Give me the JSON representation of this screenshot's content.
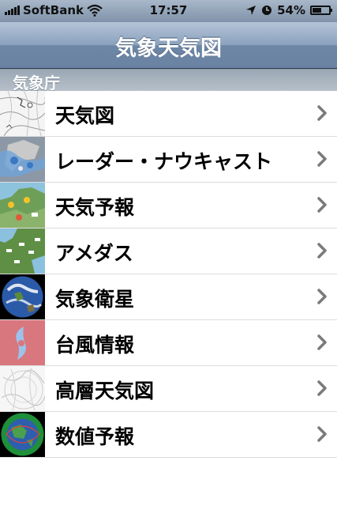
{
  "status_bar": {
    "carrier": "SoftBank",
    "time": "17:57",
    "battery_percent": "54%",
    "battery_level": 0.54,
    "icons": [
      "signal-bars-icon",
      "wifi-icon",
      "location-arrow-icon",
      "alarm-clock-icon",
      "battery-icon"
    ]
  },
  "navbar": {
    "title": "気象天気図"
  },
  "section": {
    "header": "気象庁"
  },
  "list": {
    "items": [
      {
        "label": "天気図",
        "thumb": "weather-chart-thumbnail"
      },
      {
        "label": "レーダー・ナウキャスト",
        "thumb": "radar-nowcast-thumbnail"
      },
      {
        "label": "天気予報",
        "thumb": "forecast-map-thumbnail"
      },
      {
        "label": "アメダス",
        "thumb": "amedas-map-thumbnail"
      },
      {
        "label": "気象衛星",
        "thumb": "satellite-earth-thumbnail"
      },
      {
        "label": "台風情報",
        "thumb": "typhoon-symbol-thumbnail"
      },
      {
        "label": "高層天気図",
        "thumb": "upper-air-chart-thumbnail"
      },
      {
        "label": "数値予報",
        "thumb": "numerical-forecast-globe-thumbnail"
      }
    ]
  },
  "colors": {
    "nav_gradient_top": "#b4c4d8",
    "nav_gradient_bottom": "#6a83a3",
    "typhoon_bg": "#d9777e",
    "typhoon_symbol": "#9cc3ec"
  }
}
